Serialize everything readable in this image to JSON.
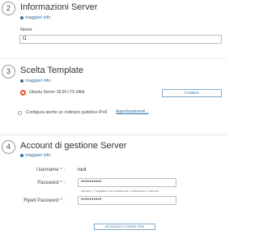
{
  "step2": {
    "number": "2",
    "title": "Informazioni Server",
    "info_link": "maggiori info",
    "name_label": "Nome",
    "name_value": "t1"
  },
  "step3": {
    "number": "3",
    "title": "Scelta Template",
    "info_link": "maggiori info",
    "template_name": "Ubuntu Server 18.04 LTS 64bit",
    "change_button": "CAMBIA",
    "ipv6_label": "Configura anche un indirizzo pubblico IPv6",
    "learn_more": "Approfondimenti..."
  },
  "step4": {
    "number": "4",
    "title": "Account di gestione Server",
    "info_link": "maggiori info",
    "username_label": "Username",
    "username_value": "root",
    "password_label": "Password",
    "password_value": "••••••••••",
    "password_hint": "Almeno 7 caratteri con maiuscole, minuscole e numeri",
    "repeat_label": "Ripeti Password",
    "repeat_value": "••••••••••",
    "add_ssh_button": "AGGIUNGI CHIAVE SSH",
    "required_marker": "*"
  },
  "colors": {
    "accent": "#2d6fa3",
    "ubuntu": "#e95420",
    "required": "#c0392b"
  }
}
